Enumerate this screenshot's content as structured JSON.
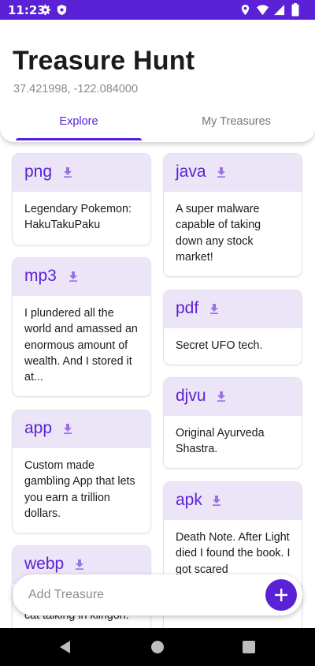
{
  "status_bar": {
    "time": "11:23"
  },
  "header": {
    "title": "Treasure Hunt",
    "coords": "37.421998, -122.084000",
    "tabs": [
      {
        "label": "Explore"
      },
      {
        "label": "My Treasures"
      }
    ]
  },
  "cards": [
    {
      "title": "png",
      "text": "Legendary Pokemon: HakuTakuPaku"
    },
    {
      "title": "mp3",
      "text": "I plundered all the world and amassed an enormous amount of wealth. And I stored it at..."
    },
    {
      "title": "app",
      "text": "Custom made gambling App that lets you earn a trillion dollars."
    },
    {
      "title": "webp",
      "text": "cat talking in klingon."
    },
    {
      "title": "java",
      "text": "A super malware capable of taking down any stock market!"
    },
    {
      "title": "pdf",
      "text": "Secret UFO tech."
    },
    {
      "title": "djvu",
      "text": "Original Ayurveda Shastra."
    },
    {
      "title": "apk",
      "text": "Death Note. After Light died I found the book. I got scared"
    }
  ],
  "add_bar": {
    "placeholder": "Add Treasure"
  },
  "colors": {
    "accent": "#5b21d6",
    "card_header": "#ece5f7"
  }
}
